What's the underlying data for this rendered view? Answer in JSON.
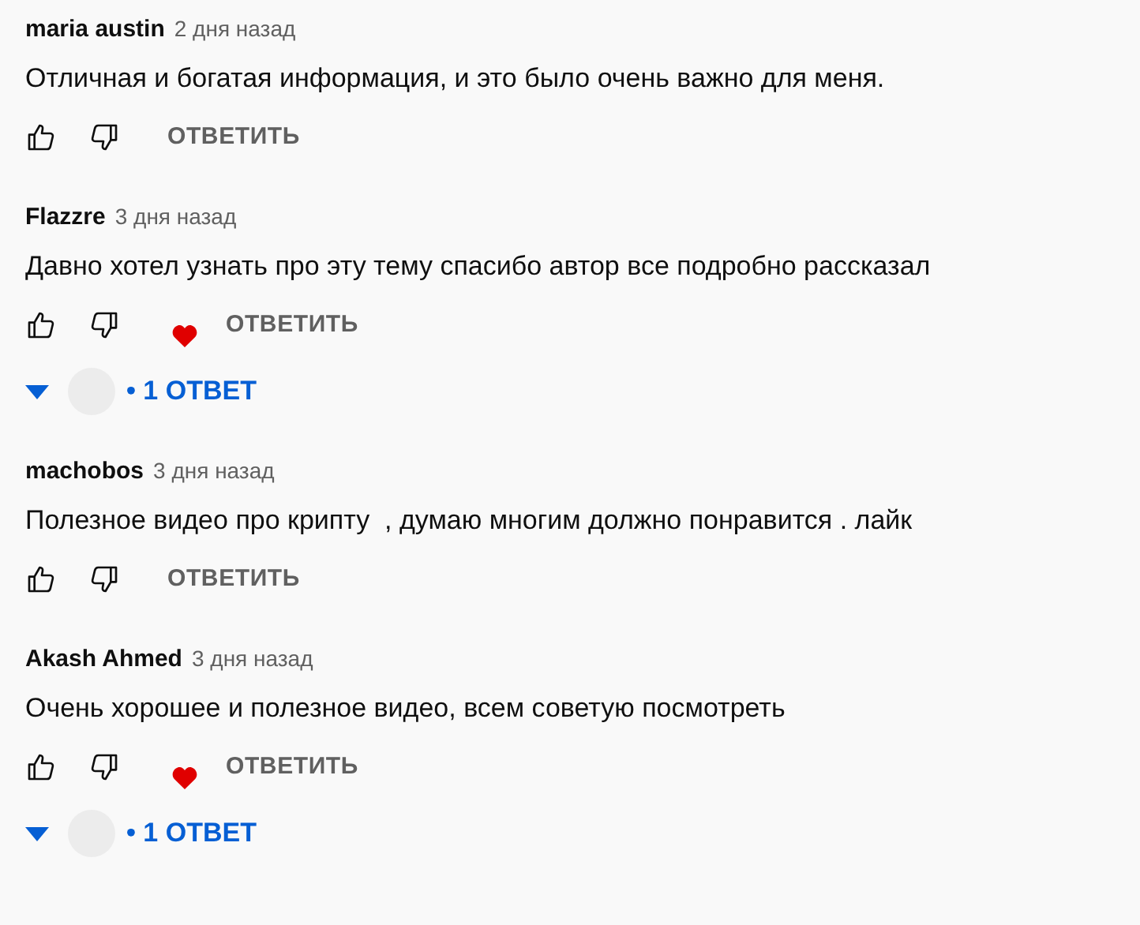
{
  "comments": [
    {
      "author": "maria austin",
      "time": "2 дня назад",
      "text": "Отличная и богатая информация, и это было очень важно для меня.",
      "hearted": false,
      "reply_button": "ОТВЕТИТЬ"
    },
    {
      "author": "Flazzre",
      "time": "3 дня назад",
      "text": "Давно хотел узнать про эту тему спасибо автор все подробно рассказал",
      "hearted": true,
      "reply_button": "ОТВЕТИТЬ",
      "replies": {
        "expanded": false,
        "label": "• 1 ОТВЕТ"
      }
    },
    {
      "author": "machobos",
      "time": "3 дня назад",
      "text": "Полезное видео про крипту  , думаю многим должно понравится . лайк",
      "hearted": false,
      "reply_button": "ОТВЕТИТЬ"
    },
    {
      "author": "Akash Ahmed",
      "time": "3 дня назад",
      "text": "Очень хорошее и полезное видео, всем советую посмотреть",
      "hearted": true,
      "reply_button": "ОТВЕТИТЬ",
      "replies": {
        "expanded": false,
        "label": "• 1 ОТВЕТ"
      }
    }
  ]
}
